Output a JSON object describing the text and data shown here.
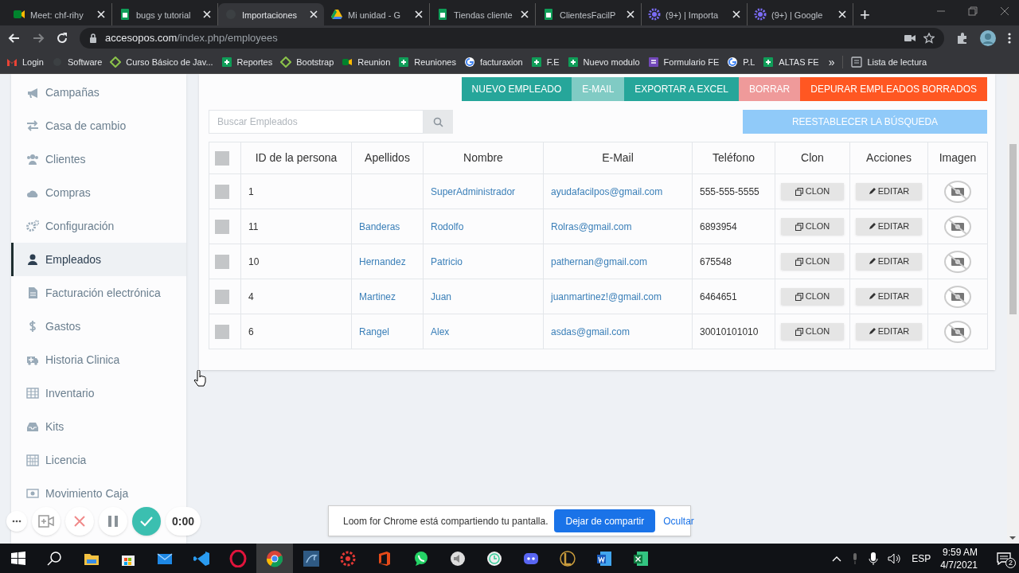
{
  "browser": {
    "tabs": [
      {
        "title": "Meet: chf-rihy",
        "selected": false
      },
      {
        "title": "bugs y tutorial",
        "selected": false
      },
      {
        "title": "Importaciones",
        "selected": true
      },
      {
        "title": "Mi unidad - G",
        "selected": false
      },
      {
        "title": "Tiendas cliente",
        "selected": false
      },
      {
        "title": "ClientesFacilP",
        "selected": false
      },
      {
        "title": "(9+) | Importa",
        "selected": false
      },
      {
        "title": "(9+) | Google",
        "selected": false
      }
    ],
    "new_tab": "+",
    "address": {
      "domain": "accesopos.com",
      "path": "/index.php/employees"
    },
    "bookmarks": [
      "Login",
      "Software",
      "Curso Básico de Jav...",
      "Reportes",
      "Bootstrap",
      "Reunion",
      "Reuniones",
      "facturaxion",
      "F.E",
      "Nuevo modulo",
      "Formulario FE",
      "P.L",
      "ALTAS FE"
    ],
    "more_bookmarks": "»",
    "reading_list": "Lista de lectura"
  },
  "sidebar": {
    "items": [
      {
        "label": "Campañas",
        "selected": false
      },
      {
        "label": "Casa de cambio",
        "selected": false
      },
      {
        "label": "Clientes",
        "selected": false
      },
      {
        "label": "Compras",
        "selected": false
      },
      {
        "label": "Configuración",
        "selected": false
      },
      {
        "label": "Empleados",
        "selected": true
      },
      {
        "label": "Facturación electrónica",
        "selected": false
      },
      {
        "label": "Gastos",
        "selected": false
      },
      {
        "label": "Historia Clinica",
        "selected": false
      },
      {
        "label": "Inventario",
        "selected": false
      },
      {
        "label": "Kits",
        "selected": false
      },
      {
        "label": "Licencia",
        "selected": false
      },
      {
        "label": "Movimiento Caja",
        "selected": false
      }
    ]
  },
  "toolbar": {
    "buttons": [
      {
        "label": "NUEVO EMPLEADO",
        "kind": "primary"
      },
      {
        "label": "E-MAIL",
        "kind": "light"
      },
      {
        "label": "EXPORTAR A EXCEL",
        "kind": "primary"
      },
      {
        "label": "BORRAR",
        "kind": "danger-light"
      },
      {
        "label": "DEPURAR EMPLEADOS BORRADOS",
        "kind": "warning"
      }
    ]
  },
  "search": {
    "placeholder": "Buscar Empleados"
  },
  "reset_button": "REESTABLECER LA BÚSQUEDA",
  "table": {
    "select_all": {
      "checked": false
    },
    "columns": [
      "ID de la persona",
      "Apellidos",
      "Nombre",
      "E-Mail",
      "Teléfono",
      "Clon",
      "Acciones",
      "Imagen"
    ],
    "rows": [
      {
        "checked": false,
        "id": "1",
        "nombre": "SuperAdministrador",
        "email": "ayudafacilpos@gmail.com",
        "telefono": "555-555-5555",
        "clone_button": "CLON",
        "edit_button": "EDITAR"
      },
      {
        "checked": false,
        "id": "11",
        "apellidos": "Banderas",
        "nombre": "Rodolfo",
        "email": "Rolras@gmail.com",
        "telefono": "6893954",
        "clone_button": "CLON",
        "edit_button": "EDITAR"
      },
      {
        "checked": false,
        "id": "10",
        "apellidos": "Hernandez",
        "nombre": "Patricio",
        "email": "pathernan@gmail.com",
        "telefono": "675548",
        "clone_button": "CLON",
        "edit_button": "EDITAR"
      },
      {
        "checked": false,
        "id": "4",
        "apellidos": "Martinez",
        "nombre": "Juan",
        "email": "juanmartinez!@gmail.com",
        "telefono": "6464651",
        "clone_button": "CLON",
        "edit_button": "EDITAR"
      },
      {
        "checked": false,
        "id": "6",
        "apellidos": "Rangel",
        "nombre": "Alex",
        "email": "asdas@gmail.com",
        "telefono": "30010101010",
        "clone_button": "CLON",
        "edit_button": "EDITAR"
      }
    ]
  },
  "recorder": {
    "timer": "0:00"
  },
  "sharing_bar": {
    "message": "Loom for Chrome está compartiendo tu pantalla.",
    "stop_button": "Dejar de compartir",
    "hide_link": "Ocultar"
  },
  "taskbar": {
    "language": "ESP",
    "time": "9:59 AM",
    "date": "4/7/2021",
    "notifications": "2"
  }
}
